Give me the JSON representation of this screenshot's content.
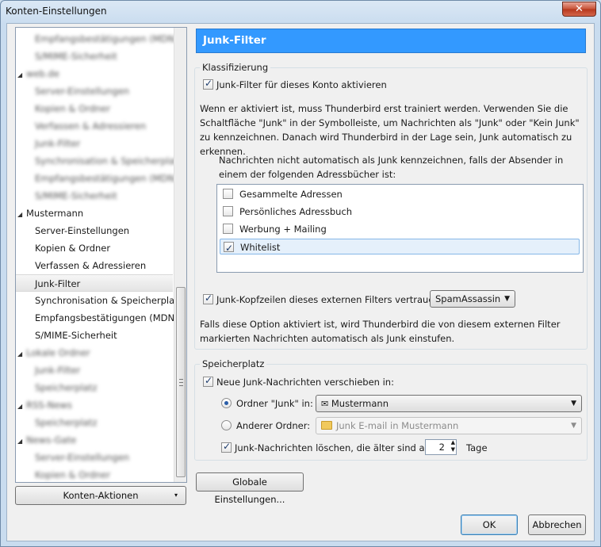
{
  "window": {
    "title": "Konten-Einstellungen",
    "close_glyph": "✕"
  },
  "tree": {
    "items": [
      {
        "label": "Empfangsbestätigungen (MDN)",
        "level": "child",
        "blurred": true
      },
      {
        "label": "S/MIME-Sicherheit",
        "level": "child",
        "blurred": true
      },
      {
        "label": "web.de",
        "level": "parent",
        "blurred": true
      },
      {
        "label": "Server-Einstellungen",
        "level": "child",
        "blurred": true
      },
      {
        "label": "Kopien & Ordner",
        "level": "child",
        "blurred": true
      },
      {
        "label": "Verfassen & Adressieren",
        "level": "child",
        "blurred": true
      },
      {
        "label": "Junk-Filter",
        "level": "child",
        "blurred": true
      },
      {
        "label": "Synchronisation & Speicherplatz",
        "level": "child",
        "blurred": true
      },
      {
        "label": "Empfangsbestätigungen (MDN)",
        "level": "child",
        "blurred": true
      },
      {
        "label": "S/MIME-Sicherheit",
        "level": "child",
        "blurred": true
      },
      {
        "label": "Mustermann",
        "level": "parent",
        "blurred": false
      },
      {
        "label": "Server-Einstellungen",
        "level": "child",
        "blurred": false
      },
      {
        "label": "Kopien & Ordner",
        "level": "child",
        "blurred": false
      },
      {
        "label": "Verfassen & Adressieren",
        "level": "child",
        "blurred": false
      },
      {
        "label": "Junk-Filter",
        "level": "child",
        "blurred": false,
        "selected": true
      },
      {
        "label": "Synchronisation & Speicherplatz",
        "level": "child",
        "blurred": false
      },
      {
        "label": "Empfangsbestätigungen (MDN)",
        "level": "child",
        "blurred": false
      },
      {
        "label": "S/MIME-Sicherheit",
        "level": "child",
        "blurred": false
      },
      {
        "label": "Lokale Ordner",
        "level": "parent",
        "blurred": true
      },
      {
        "label": "Junk-Filter",
        "level": "child",
        "blurred": true
      },
      {
        "label": "Speicherplatz",
        "level": "child",
        "blurred": true
      },
      {
        "label": "RSS-News",
        "level": "parent",
        "blurred": true
      },
      {
        "label": "Speicherplatz",
        "level": "child",
        "blurred": true
      },
      {
        "label": "News-Gate",
        "level": "parent",
        "blurred": true
      },
      {
        "label": "Server-Einstellungen",
        "level": "child",
        "blurred": true
      },
      {
        "label": "Kopien & Ordner",
        "level": "child",
        "blurred": true
      }
    ],
    "expander_glyph": "◢",
    "scroll_position": 0.72
  },
  "account_actions_button": "Konten-Aktionen",
  "header": "Junk-Filter",
  "classification": {
    "legend": "Klassifizierung",
    "enable_label": "Junk-Filter für dieses Konto aktivieren",
    "enable_checked": true,
    "info_text": "Wenn er aktiviert ist, muss Thunderbird erst trainiert werden. Verwenden Sie die Schaltfläche \"Junk\" in der Symbolleiste, um Nachrichten als \"Junk\" oder \"Kein Junk\" zu kennzeichnen. Danach wird Thunderbird in der Lage sein, Junk automatisch zu erkennen.",
    "whitelist_intro": "Nachrichten nicht automatisch als Junk kennzeichnen, falls der Absender in einem der folgenden Adressbücher ist:",
    "address_books": [
      {
        "label": "Gesammelte Adressen",
        "checked": false
      },
      {
        "label": "Persönliches Adressbuch",
        "checked": false
      },
      {
        "label": "Werbung + Mailing",
        "checked": false
      },
      {
        "label": "Whitelist",
        "checked": true,
        "selected": true
      }
    ],
    "trust_headers_label": "Junk-Kopfzeilen dieses externen Filters vertrauen:",
    "trust_headers_checked": true,
    "external_filter": "SpamAssassin",
    "trust_info": "Falls diese Option aktiviert ist, wird Thunderbird die von diesem externen Filter markierten Nachrichten automatisch als Junk einstufen."
  },
  "storage": {
    "legend": "Speicherplatz",
    "move_label": "Neue Junk-Nachrichten verschieben in:",
    "move_checked": true,
    "junk_folder_label": "Ordner \"Junk\" in:",
    "junk_folder_value": "Mustermann",
    "other_folder_label": "Anderer Ordner:",
    "other_folder_value": "Junk E-mail in Mustermann",
    "selected_option": "junk_folder",
    "delete_label": "Junk-Nachrichten löschen, die älter sind als",
    "delete_checked": true,
    "delete_days": "2",
    "days_unit": "Tage"
  },
  "global_settings_button": "Globale Einstellungen...",
  "ok_button": "OK",
  "cancel_button": "Abbrechen"
}
